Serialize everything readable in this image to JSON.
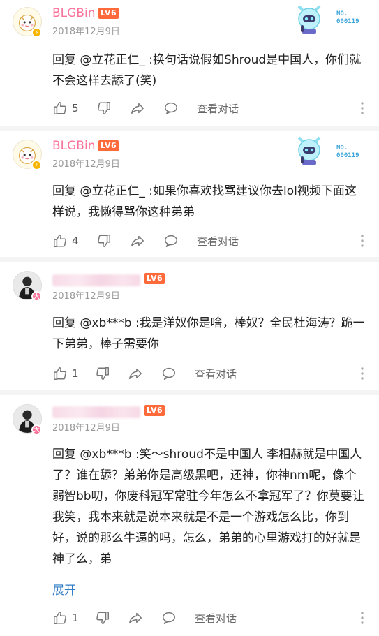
{
  "comments": [
    {
      "username": "BLGBin",
      "level": "LV6",
      "date": "2018年12月9日",
      "text": "回复 @立花正仁_ :换句话说假如Shroud是中国人，你们就不会这样去舔了(笑)",
      "likes": "5",
      "view_conversation": "查看对话",
      "fan_badge": "NO.\n000119"
    },
    {
      "username": "BLGBin",
      "level": "LV6",
      "date": "2018年12月9日",
      "text": "回复 @立花正仁_ :如果你喜欢找骂建议你去lol视频下面这样说，我懒得骂你这种弟弟",
      "likes": "4",
      "view_conversation": "查看对话",
      "fan_badge": "NO.\n000119"
    },
    {
      "username": "",
      "level": "LV6",
      "date": "2018年12月9日",
      "text": "回复 @xb***b :我是洋奴你是啥，棒奴？全民杜海涛？跪一下弟弟，棒子需要你",
      "likes": "1",
      "view_conversation": "查看对话"
    },
    {
      "username": "",
      "level": "LV6",
      "date": "2018年12月9日",
      "text": "回复 @xb***b :笑～shroud不是中国人  李相赫就是中国人了？谁在舔？弟弟你是高级黑吧，还神，你神nm呢，像个弱智bb叨，你废科冠军常驻今年怎么不拿冠军了？你莫要让我笑，我本来就是说本来就是不是一个游戏怎么比，你到好，说的那么牛逼的吗，怎么，弟弟的心里游戏打的好就是神了么，弟",
      "expand": "展开",
      "likes": "1",
      "view_conversation": "查看对话"
    }
  ],
  "colors": {
    "username_pink": "#fb7299",
    "level_badge": "#ff6a3b",
    "link_blue": "#2e7bc6",
    "meta_gray": "#999999"
  },
  "icons": [
    "thumbs-up-icon",
    "thumbs-down-icon",
    "share-icon",
    "comment-icon",
    "more-vertical-icon"
  ]
}
